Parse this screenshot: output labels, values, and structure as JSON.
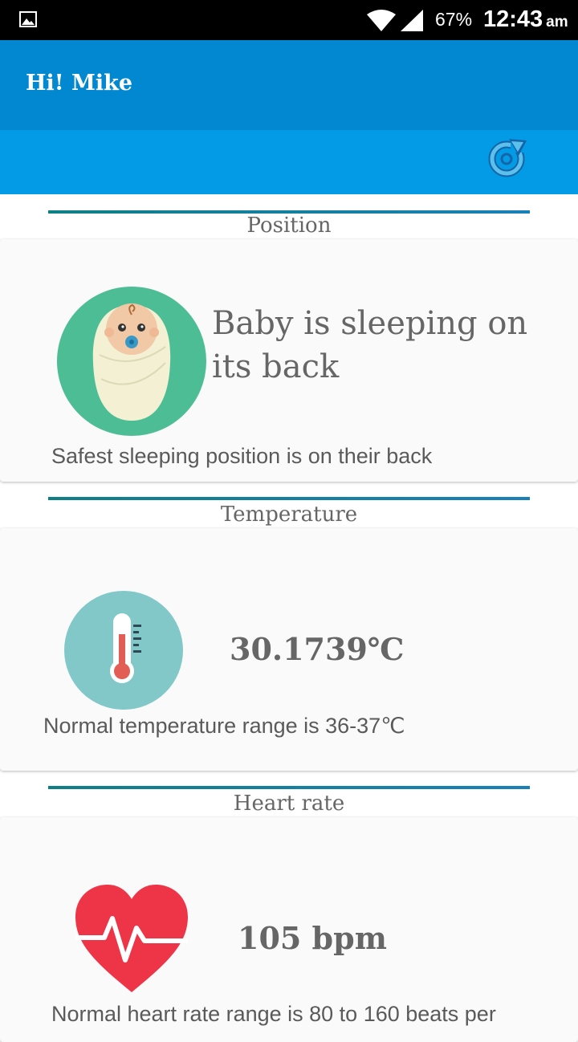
{
  "status_bar": {
    "battery": "67%",
    "time": "12:43",
    "ampm": "am",
    "icons": [
      "gallery-icon",
      "wifi-icon",
      "signal-icon"
    ]
  },
  "app_bar": {
    "title": "Hi! Mike"
  },
  "toolbar": {
    "refresh_icon": "refresh-icon"
  },
  "colors": {
    "app_bar": "#0288d1",
    "sub_bar": "#039be5",
    "divider": "#0f7f86",
    "baby_circle": "#4dbd95",
    "thermo_circle": "#82c8c9",
    "heart": "#ee3548"
  },
  "sections": {
    "position": {
      "title": "Position",
      "main": "Baby is sleeping on its back",
      "note": "Safest sleeping position is on their back",
      "icon": "baby-icon"
    },
    "temperature": {
      "title": "Temperature",
      "value": "30.1739℃",
      "note": "Normal temperature range is 36-37℃",
      "icon": "thermometer-icon"
    },
    "heart_rate": {
      "title": "Heart rate",
      "value": "105 bpm",
      "note": "Normal heart rate range is 80 to 160 beats per",
      "icon": "heart-icon"
    }
  }
}
